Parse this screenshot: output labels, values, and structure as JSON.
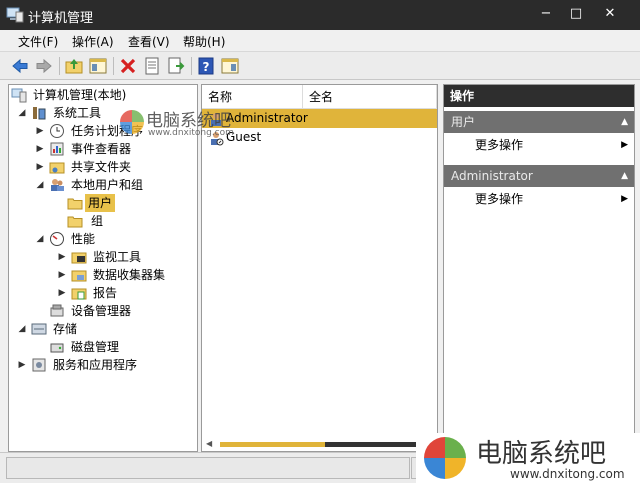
{
  "window": {
    "title": "计算机管理",
    "controls": {
      "minimize": "−",
      "maximize": "□",
      "close": "✕"
    }
  },
  "menu": [
    "文件(F)",
    "操作(A)",
    "查看(V)",
    "帮助(H)"
  ],
  "toolbar": [
    "back-icon",
    "forward-icon",
    "up-folder-icon",
    "show-tree-icon",
    "delete-icon",
    "properties-icon",
    "export-icon",
    "help-icon",
    "show-action-pane-icon"
  ],
  "tree": {
    "root": "计算机管理(本地)",
    "system_tools": "系统工具",
    "task_scheduler": "任务计划程序",
    "event_viewer": "事件查看器",
    "shared_folders": "共享文件夹",
    "local_users_groups": "本地用户和组",
    "users": "用户",
    "groups": "组",
    "performance": "性能",
    "monitoring_tools": "监视工具",
    "data_collector_sets": "数据收集器集",
    "reports": "报告",
    "device_manager": "设备管理器",
    "storage": "存储",
    "disk_management": "磁盘管理",
    "services_apps": "服务和应用程序",
    "expand_glyph": "▶",
    "collapse_glyph": "◢"
  },
  "list": {
    "columns": [
      "名称",
      "全名"
    ],
    "rows": [
      {
        "name": "Administrator",
        "full_name": "",
        "selected": true
      },
      {
        "name": "Guest",
        "full_name": "",
        "selected": false
      }
    ],
    "scroll_left": "◀",
    "scroll_fraction": 0.52
  },
  "actions": {
    "header": "操作",
    "sections": [
      {
        "title": "用户",
        "item": "更多操作"
      },
      {
        "title": "Administrator",
        "item": "更多操作"
      }
    ],
    "caret": "▲",
    "arrow": "▶"
  },
  "watermark": {
    "text": "电脑系统吧",
    "url": "www.dnxitong.com"
  },
  "colors": {
    "titlebar": "#2b2b2b",
    "selection": "#e0b43a",
    "action_header": "#2e2e2e",
    "action_section": "#707070"
  }
}
